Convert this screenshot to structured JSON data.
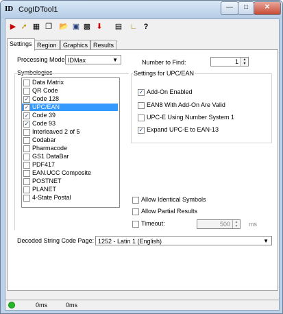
{
  "window": {
    "title": "CogIDTool1",
    "app_icon": "ID"
  },
  "toolbar": {
    "icons": [
      "play-icon",
      "wand-icon",
      "barcode-icon",
      "copy-icon",
      "open-folder-icon",
      "save-icon",
      "config-icon",
      "import-icon",
      "image-icon",
      "chart-icon",
      "help-icon"
    ]
  },
  "tabs": [
    "Settings",
    "Region",
    "Graphics",
    "Results"
  ],
  "settings": {
    "processing_mode_label": "Processing Mode:",
    "processing_mode_value": "IDMax",
    "number_to_find_label": "Number to Find:",
    "number_to_find_value": "1",
    "symbologies_label": "Symbologies",
    "symbologies": [
      {
        "name": "Data Matrix",
        "checked": false
      },
      {
        "name": "QR Code",
        "checked": false
      },
      {
        "name": "Code 128",
        "checked": true
      },
      {
        "name": "UPC/EAN",
        "checked": true,
        "selected": true
      },
      {
        "name": "Code 39",
        "checked": true
      },
      {
        "name": "Code 93",
        "checked": true
      },
      {
        "name": "Interleaved 2 of 5",
        "checked": false
      },
      {
        "name": "Codabar",
        "checked": false
      },
      {
        "name": "Pharmacode",
        "checked": false
      },
      {
        "name": "GS1 DataBar",
        "checked": false
      },
      {
        "name": "PDF417",
        "checked": false
      },
      {
        "name": "EAN.UCC Composite",
        "checked": false
      },
      {
        "name": "POSTNET",
        "checked": false
      },
      {
        "name": "PLANET",
        "checked": false
      },
      {
        "name": "4-State Postal",
        "checked": false
      }
    ],
    "upc_group_label": "Settings for UPC/EAN",
    "upc_options": [
      {
        "label": "Add-On Enabled",
        "checked": true
      },
      {
        "label": "EAN8 With Add-On Are Valid",
        "checked": false
      },
      {
        "label": "UPC-E Using Number System 1",
        "checked": false
      },
      {
        "label": "Expand UPC-E to EAN-13",
        "checked": true
      }
    ],
    "allow_identical_label": "Allow Identical Symbols",
    "allow_partial_label": "Allow Partial Results",
    "timeout_label": "Timeout:",
    "timeout_value": "500",
    "timeout_unit": "ms",
    "code_page_label": "Decoded String Code Page:",
    "code_page_value": "1252 - Latin 1 (English)"
  },
  "status": {
    "time1": "0ms",
    "time2": "0ms",
    "led_color": "#27b827"
  }
}
